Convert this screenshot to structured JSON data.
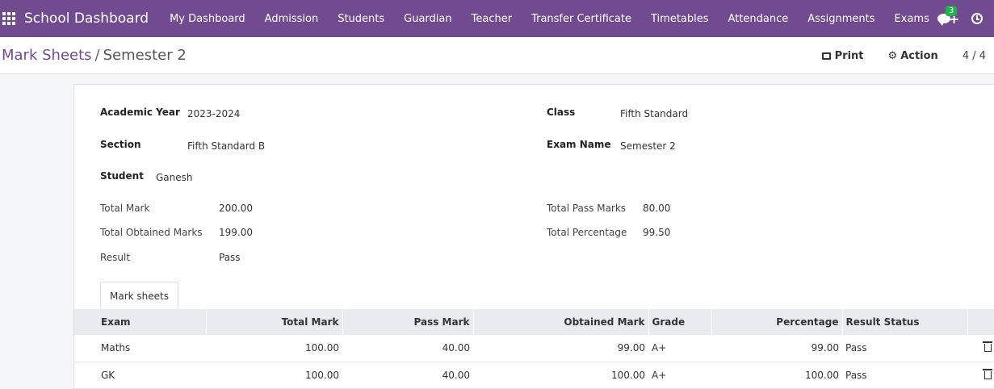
{
  "navbar": {
    "brand": "School Dashboard",
    "menu": [
      "My Dashboard",
      "Admission",
      "Students",
      "Guardian",
      "Teacher",
      "Transfer Certificate",
      "Timetables",
      "Attendance",
      "Assignments",
      "Exams"
    ],
    "plus": "+",
    "chat_badge": "3"
  },
  "control_panel": {
    "breadcrumb_parent": "Mark Sheets",
    "breadcrumb_sep": "/",
    "breadcrumb_current": "Semester 2",
    "print_label": "Print",
    "action_label": "Action",
    "pager": "4 / 4"
  },
  "form": {
    "academic_year_label": "Academic Year",
    "academic_year": "2023-2024",
    "class_label": "Class",
    "class": "Fifth Standard",
    "section_label": "Section",
    "section": "Fifth Standard B",
    "exam_name_label": "Exam Name",
    "exam_name": "Semester 2",
    "student_label": "Student",
    "student": "Ganesh",
    "total_mark_label": "Total Mark",
    "total_mark": "200.00",
    "total_pass_label": "Total Pass Marks",
    "total_pass": "80.00",
    "total_obtained_label": "Total Obtained Marks",
    "total_obtained": "199.00",
    "total_percentage_label": "Total Percentage",
    "total_percentage": "99.50",
    "result_label": "Result",
    "result": "Pass"
  },
  "tab_label": "Mark sheets",
  "table": {
    "headers": [
      "Exam",
      "Total Mark",
      "Pass Mark",
      "Obtained Mark",
      "Grade",
      "Percentage",
      "Result Status"
    ],
    "rows": [
      [
        "Maths",
        "100.00",
        "40.00",
        "99.00",
        "A+",
        "99.00",
        "Pass"
      ],
      [
        "GK",
        "100.00",
        "40.00",
        "100.00",
        "A+",
        "100.00",
        "Pass"
      ]
    ]
  }
}
